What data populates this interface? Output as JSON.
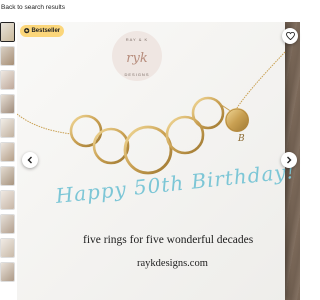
{
  "nav": {
    "back_label": "Back to search results"
  },
  "badge": {
    "label": "Bestseller",
    "icon": "medal-icon",
    "color": "#fbd67a"
  },
  "logo": {
    "top_text": "RAY & K",
    "mark_text": "ryk",
    "bottom_text": "DESIGNS"
  },
  "card": {
    "headline": "Happy 50th Birthday!",
    "tagline": "five rings for five wonderful decades",
    "website": "raykdesigns.com",
    "pendant_letter": "B",
    "headline_color": "#7cc6d6"
  },
  "gallery": {
    "thumbnail_count": 12,
    "selected_index": 0
  },
  "icons": {
    "favorite": "heart-icon",
    "prev": "chevron-left-icon",
    "next": "chevron-right-icon"
  }
}
